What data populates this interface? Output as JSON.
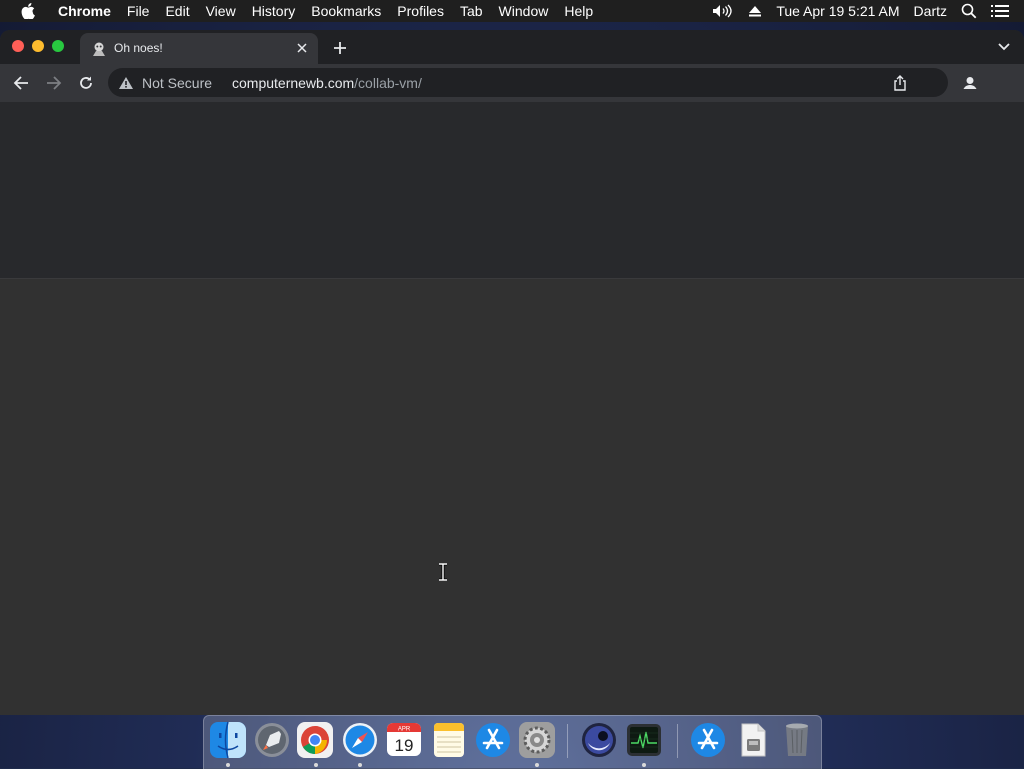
{
  "menubar": {
    "app_name": "Chrome",
    "menus": [
      "File",
      "Edit",
      "View",
      "History",
      "Bookmarks",
      "Profiles",
      "Tab",
      "Window",
      "Help"
    ],
    "clock": "Tue Apr 19  5:21 AM",
    "user": "Dartz"
  },
  "tab": {
    "title": "Oh noes!"
  },
  "omnibox": {
    "security_label": "Not Secure",
    "url_host": "computernewb.com",
    "url_path": "/collab-vm/"
  },
  "dock": {
    "calendar_month": "APR",
    "calendar_day": "19",
    "items": [
      "finder-icon",
      "launchpad-icon",
      "chrome-icon",
      "safari-icon",
      "calendar-icon",
      "notes-icon",
      "app-store-icon",
      "system-preferences-icon",
      "cinema4d-icon",
      "activity-monitor-icon",
      "app-store-download-icon",
      "document-icon",
      "trash-icon"
    ]
  },
  "colors": {
    "menubar_bg": "#1f1f1f",
    "tabstrip_bg": "#202124",
    "toolbar_bg": "#35363a",
    "content_top": "#28292c",
    "content_main": "#313131",
    "close": "#ff5f57",
    "minimize": "#febc2e",
    "maximize": "#28c840"
  }
}
